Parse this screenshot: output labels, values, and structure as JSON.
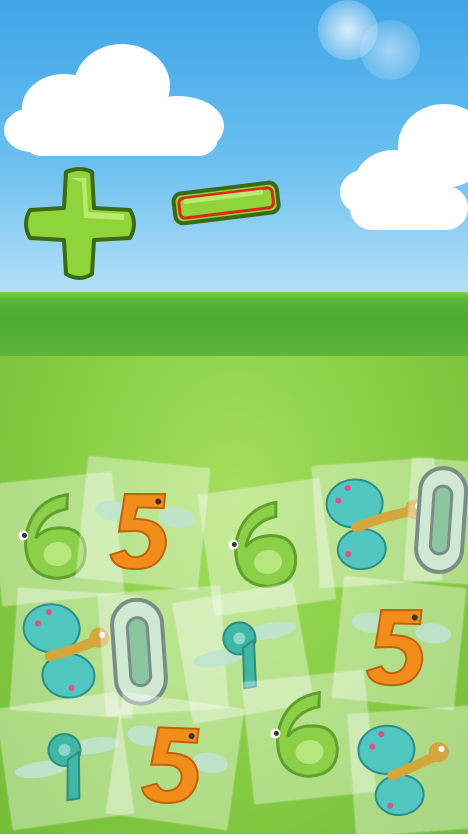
{
  "controls": {
    "plus": {
      "icon": "plus-icon"
    },
    "minus": {
      "icon": "minus-icon",
      "selected": true
    }
  },
  "cards": [
    {
      "glyph": "six"
    },
    {
      "glyph": "five"
    },
    {
      "glyph": "six"
    },
    {
      "glyph": "butterfly"
    },
    {
      "glyph": "zero"
    },
    {
      "glyph": "butterfly"
    },
    {
      "glyph": "zero"
    },
    {
      "glyph": "nine"
    },
    {
      "glyph": "five"
    },
    {
      "glyph": "nine"
    },
    {
      "glyph": "five"
    },
    {
      "glyph": "six"
    },
    {
      "glyph": "butterfly"
    }
  ],
  "colors": {
    "plus_green": "#8ed43a",
    "minus_red": "#d8281c",
    "five_orange": "#f28d1c",
    "six_green": "#8cd04a",
    "nine_teal": "#3fb7a4",
    "butterfly_teal": "#52c6c0"
  }
}
